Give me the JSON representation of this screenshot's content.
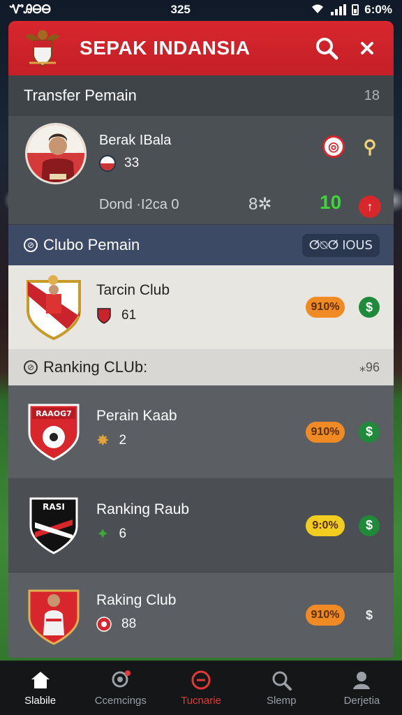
{
  "status_bar": {
    "carrier": "ᏉᎯᎾᎾ",
    "time": "325",
    "battery": "6:0%"
  },
  "header": {
    "title": "SEPAK INDANSIA"
  },
  "transfer": {
    "title": "Transfer Pemain",
    "count": "18",
    "player": {
      "name": "Berak IBala",
      "number": "33",
      "stats": "Dond ·I2ca 0",
      "rating": "8✲",
      "score": "10"
    }
  },
  "clubs_section": {
    "title": "Clubo Pemain",
    "badge": "ⵚ⍉ⵚ IOꓴꓢ"
  },
  "club_top": {
    "name": "Tarcin Club",
    "value": "61",
    "pill": "910%"
  },
  "ranking_section": {
    "title": "Ranking CLUb:",
    "count": "⁎96"
  },
  "ranking": [
    {
      "name": "Perain Kaab",
      "value": "2",
      "pill": "910%",
      "pill_color": "#f08a24",
      "dollar_color": "#1f8a3a",
      "logo_label": "RAAOG7"
    },
    {
      "name": "Ranking Raub",
      "value": "6",
      "pill": "9:0%",
      "pill_color": "#f1cd1f",
      "dollar_color": "#1f8a3a",
      "logo_label": "RASI"
    },
    {
      "name": "Raking Club",
      "value": "88",
      "pill": "910%",
      "pill_color": "#f08a24",
      "dollar_color": "transparent",
      "logo_label": ""
    }
  ],
  "nav": [
    {
      "label": "Slabile",
      "icon": "home-icon"
    },
    {
      "label": "Ccemcings",
      "icon": "location-icon"
    },
    {
      "label": "Tucnarie",
      "icon": "ball-icon"
    },
    {
      "label": "Slemp",
      "icon": "search-icon"
    },
    {
      "label": "Derjetia",
      "icon": "profile-icon"
    }
  ],
  "colors": {
    "primary_red": "#d8262d",
    "accent_green": "#3ed43a",
    "nav_bg": "#141618"
  }
}
